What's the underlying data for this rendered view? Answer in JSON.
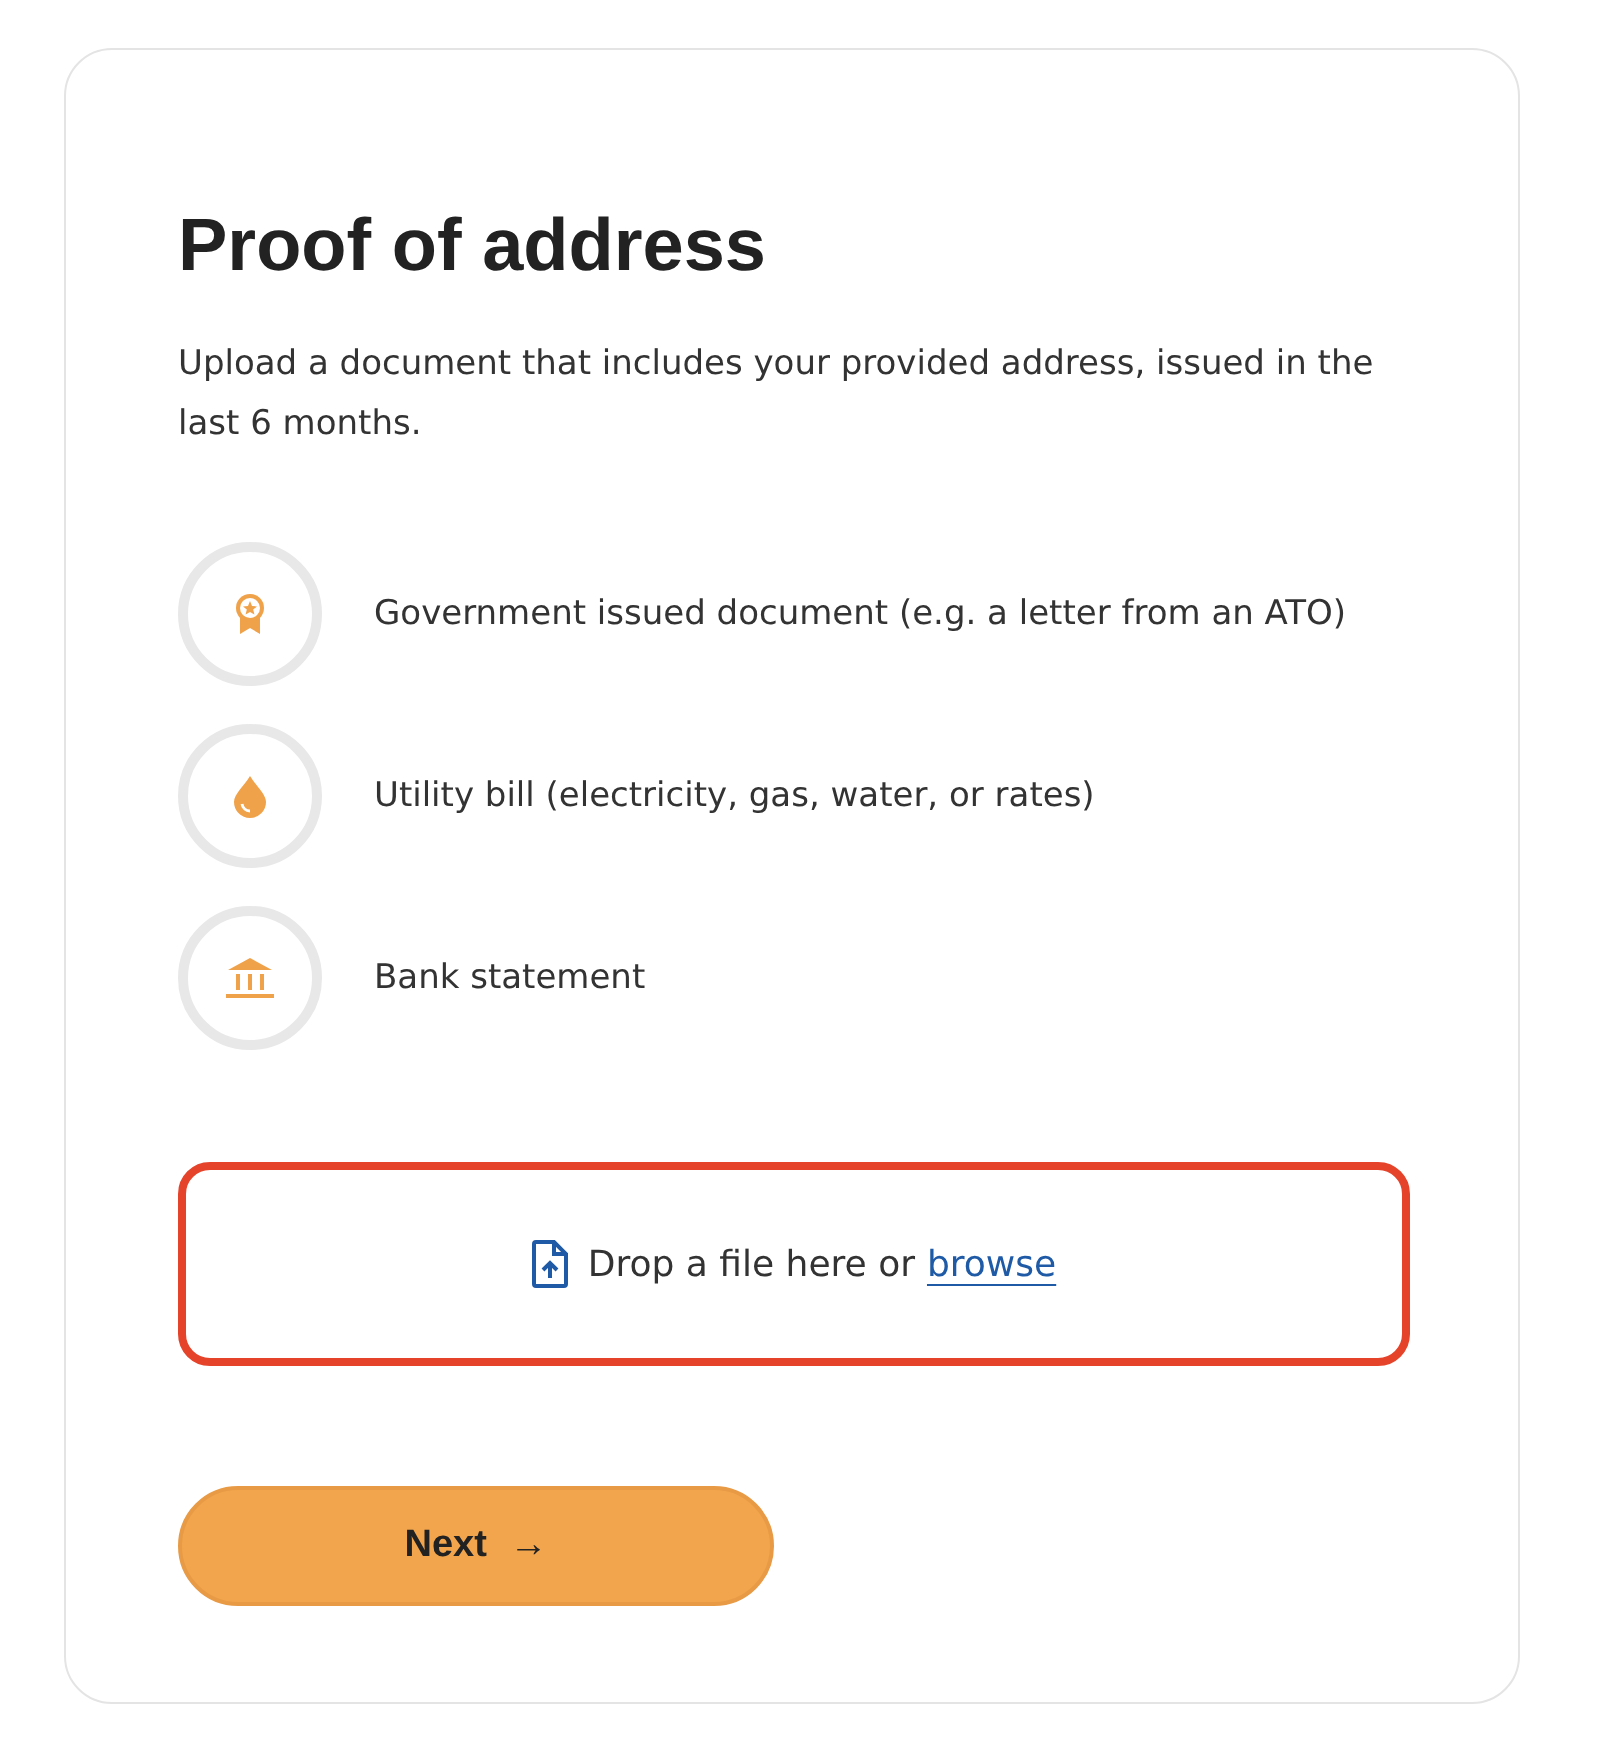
{
  "title": "Proof of address",
  "description": "Upload a document that includes your provided address, issued in the last 6 months.",
  "options": [
    {
      "kind": "award",
      "label": "Government issued document (e.g. a letter from an ATO)"
    },
    {
      "kind": "drop",
      "label": "Utility bill (electricity, gas, water, or rates)"
    },
    {
      "kind": "bank",
      "label": "Bank statement"
    }
  ],
  "dropzone": {
    "text": "Drop a file here or",
    "link": "browse",
    "error": true
  },
  "next_button": {
    "label": "Next",
    "arrow": "→"
  }
}
